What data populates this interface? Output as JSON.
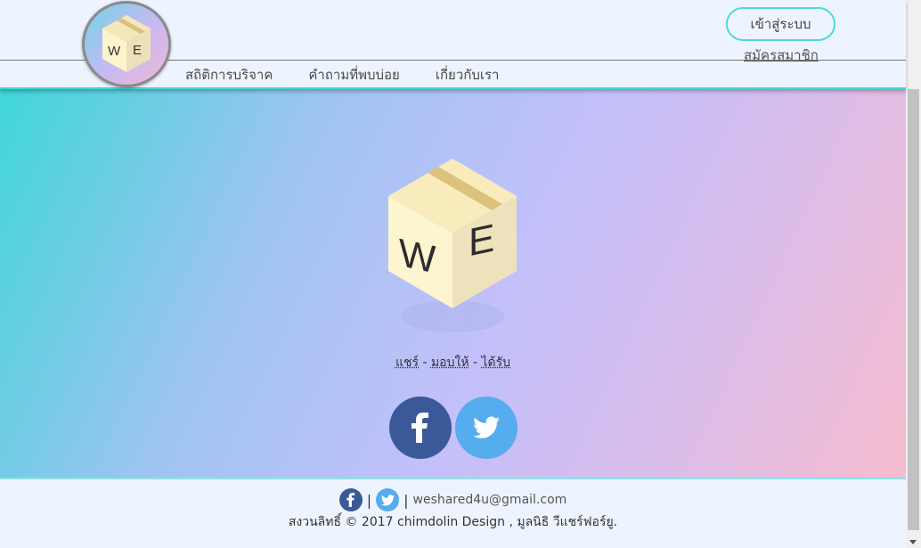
{
  "header": {
    "logo_letter_left": "W",
    "logo_letter_right": "E",
    "login_label": "เข้าสู่ระบบ",
    "register_label": "สมัครสมาชิก",
    "nav": [
      {
        "label": "สถิติการบริจาค"
      },
      {
        "label": "คำถามที่พบบ่อย"
      },
      {
        "label": "เกี่ยวกับเรา"
      }
    ]
  },
  "hero": {
    "slogan": {
      "share": "แชร์",
      "sep": " - ",
      "give": "มอบให้",
      "receive": "ได้รับ"
    },
    "social": [
      {
        "name": "facebook",
        "icon": "facebook-icon",
        "color": "#3b5998"
      },
      {
        "name": "twitter",
        "icon": "twitter-icon",
        "color": "#55acee"
      }
    ]
  },
  "footer": {
    "email": "weshared4u@gmail.com",
    "sep": "|",
    "copyright": "สงวนลิทธิ์ © 2017 chimdolin Design , มูลนิธิ วีแชร์ฟอร์ยู."
  },
  "colors": {
    "accent": "#3fd8dc",
    "facebook": "#3b5998",
    "twitter": "#55acee",
    "background": "#eef4ff"
  }
}
